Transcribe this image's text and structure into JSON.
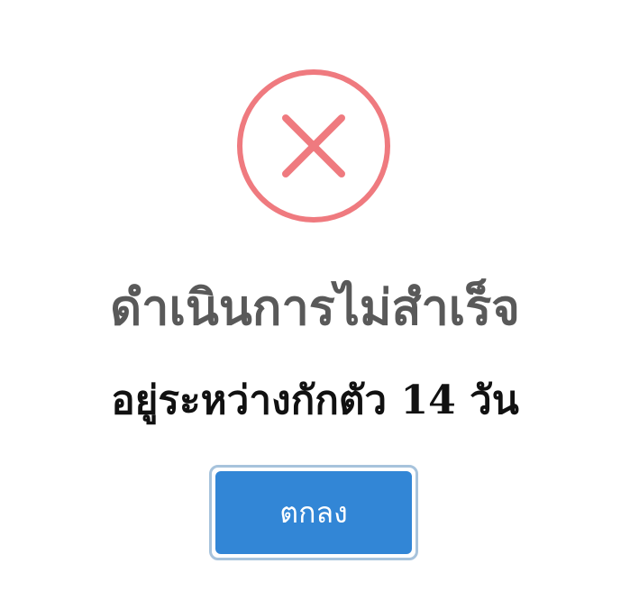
{
  "dialog": {
    "icon": "error-x-icon",
    "icon_color": "#ef7a7f",
    "title": "ดำเนินการไม่สำเร็จ",
    "message": "อยู่ระหว่างกักตัว 14 วัน",
    "confirm_label": "ตกลง",
    "button_color": "#3286d6"
  }
}
